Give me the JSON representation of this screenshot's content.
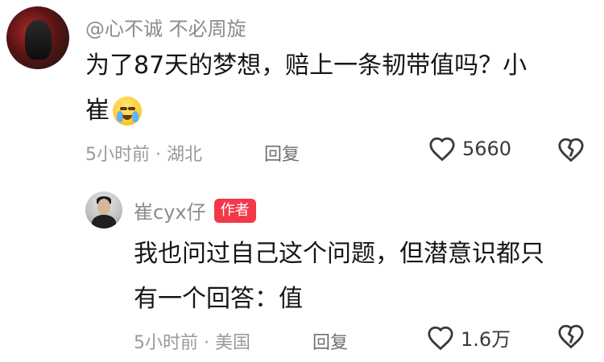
{
  "comment": {
    "username": "@心不诚 不必周旋",
    "text_line1": "为了87天的梦想，赔上一条韧带值吗？小",
    "text_line2": "崔",
    "emoji": "loudly-crying-face",
    "time_location": "5小时前 · 湖北",
    "reply_label": "回复",
    "like_count": "5660"
  },
  "reply": {
    "username": "崔cyx仔",
    "badge": "作者",
    "text_line1": "我也问过自己这个问题，但潜意识都只",
    "text_line2": "有一个回答：值",
    "time_location": "5小时前 · 美国",
    "reply_label": "回复",
    "like_count": "1.6万"
  },
  "colors": {
    "badge_bg": "#f2394a",
    "meta_text": "#999999",
    "username_text": "#8c8c8c"
  }
}
